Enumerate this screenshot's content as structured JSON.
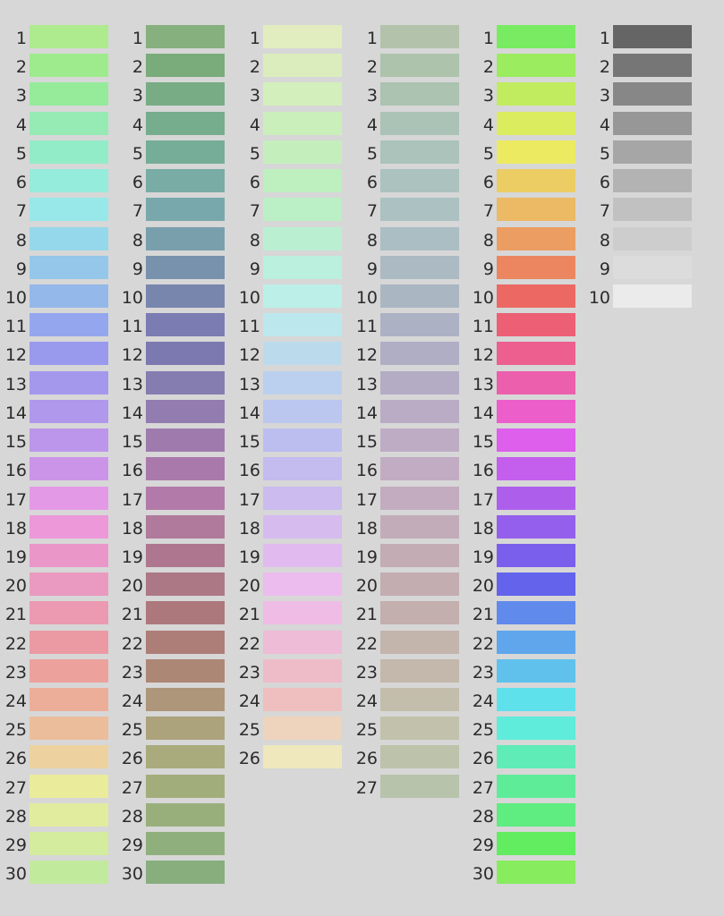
{
  "columns": [
    {
      "name": "column-1",
      "swatches": [
        {
          "num": "1",
          "color": "#aeea8e"
        },
        {
          "num": "2",
          "color": "#9eeb8e"
        },
        {
          "num": "3",
          "color": "#95eb9a"
        },
        {
          "num": "4",
          "color": "#96ebb4"
        },
        {
          "num": "5",
          "color": "#92ecc7"
        },
        {
          "num": "6",
          "color": "#95ebdc"
        },
        {
          "num": "7",
          "color": "#98e8ea"
        },
        {
          "num": "8",
          "color": "#95d8eb"
        },
        {
          "num": "9",
          "color": "#94c7ea"
        },
        {
          "num": "10",
          "color": "#95b8ea"
        },
        {
          "num": "11",
          "color": "#94a7ee"
        },
        {
          "num": "12",
          "color": "#9999ee"
        },
        {
          "num": "13",
          "color": "#a498ed"
        },
        {
          "num": "14",
          "color": "#b098ec"
        },
        {
          "num": "15",
          "color": "#bc96ea"
        },
        {
          "num": "16",
          "color": "#cc94e8"
        },
        {
          "num": "17",
          "color": "#e499e6"
        },
        {
          "num": "18",
          "color": "#ec98d9"
        },
        {
          "num": "19",
          "color": "#eb96c9"
        },
        {
          "num": "20",
          "color": "#ea9ac0"
        },
        {
          "num": "21",
          "color": "#eb9ab1"
        },
        {
          "num": "22",
          "color": "#eb9aa4"
        },
        {
          "num": "23",
          "color": "#eca19c"
        },
        {
          "num": "24",
          "color": "#ecae98"
        },
        {
          "num": "25",
          "color": "#ecbd9b"
        },
        {
          "num": "26",
          "color": "#edd29f"
        },
        {
          "num": "27",
          "color": "#ebeb9c"
        },
        {
          "num": "28",
          "color": "#e2ec9e"
        },
        {
          "num": "29",
          "color": "#d3ec9d"
        },
        {
          "num": "30",
          "color": "#c2ea9d"
        }
      ]
    },
    {
      "name": "column-2",
      "swatches": [
        {
          "num": "1",
          "color": "#86b07d"
        },
        {
          "num": "2",
          "color": "#7aab7b"
        },
        {
          "num": "3",
          "color": "#78ac84"
        },
        {
          "num": "4",
          "color": "#76ad8d"
        },
        {
          "num": "5",
          "color": "#76ad98"
        },
        {
          "num": "6",
          "color": "#78aca4"
        },
        {
          "num": "7",
          "color": "#78a8ac"
        },
        {
          "num": "8",
          "color": "#799fad"
        },
        {
          "num": "9",
          "color": "#7892ad"
        },
        {
          "num": "10",
          "color": "#7886ae"
        },
        {
          "num": "11",
          "color": "#7a7cb2"
        },
        {
          "num": "12",
          "color": "#7c78b0"
        },
        {
          "num": "13",
          "color": "#857cb0"
        },
        {
          "num": "14",
          "color": "#937caf"
        },
        {
          "num": "15",
          "color": "#9f7bad"
        },
        {
          "num": "16",
          "color": "#aa79ac"
        },
        {
          "num": "17",
          "color": "#b27aa9"
        },
        {
          "num": "18",
          "color": "#b07a9c"
        },
        {
          "num": "19",
          "color": "#ae778f"
        },
        {
          "num": "20",
          "color": "#ad7885"
        },
        {
          "num": "21",
          "color": "#ac787c"
        },
        {
          "num": "22",
          "color": "#ad7d77"
        },
        {
          "num": "23",
          "color": "#ad8776"
        },
        {
          "num": "24",
          "color": "#ad9679"
        },
        {
          "num": "25",
          "color": "#aca27b"
        },
        {
          "num": "26",
          "color": "#a9ab7c"
        },
        {
          "num": "27",
          "color": "#a2ad7c"
        },
        {
          "num": "28",
          "color": "#99af7b"
        },
        {
          "num": "29",
          "color": "#8fb07d"
        },
        {
          "num": "30",
          "color": "#88ae7e"
        }
      ]
    },
    {
      "name": "column-3",
      "swatches": [
        {
          "num": "1",
          "color": "#e1edbf"
        },
        {
          "num": "2",
          "color": "#dbedbc"
        },
        {
          "num": "3",
          "color": "#d3efbb"
        },
        {
          "num": "4",
          "color": "#caefbb"
        },
        {
          "num": "5",
          "color": "#c4efbd"
        },
        {
          "num": "6",
          "color": "#bdefbf"
        },
        {
          "num": "7",
          "color": "#bbefc6"
        },
        {
          "num": "8",
          "color": "#bbefd2"
        },
        {
          "num": "9",
          "color": "#bbefde"
        },
        {
          "num": "10",
          "color": "#bcefe8"
        },
        {
          "num": "11",
          "color": "#bce8ed"
        },
        {
          "num": "12",
          "color": "#bbdbed"
        },
        {
          "num": "13",
          "color": "#bbd0ee"
        },
        {
          "num": "14",
          "color": "#bbc7ef"
        },
        {
          "num": "15",
          "color": "#bbbeef"
        },
        {
          "num": "16",
          "color": "#c4bbef"
        },
        {
          "num": "17",
          "color": "#cbbbef"
        },
        {
          "num": "18",
          "color": "#d6bbef"
        },
        {
          "num": "19",
          "color": "#e1bbef"
        },
        {
          "num": "20",
          "color": "#ecbcee"
        },
        {
          "num": "21",
          "color": "#eebce4"
        },
        {
          "num": "22",
          "color": "#eebcd6"
        },
        {
          "num": "23",
          "color": "#eebcc8"
        },
        {
          "num": "24",
          "color": "#eebfbe"
        },
        {
          "num": "25",
          "color": "#eed4bc"
        },
        {
          "num": "26",
          "color": "#eee8bc"
        }
      ]
    },
    {
      "name": "column-4",
      "swatches": [
        {
          "num": "1",
          "color": "#b3c3ab"
        },
        {
          "num": "2",
          "color": "#adc3ac"
        },
        {
          "num": "3",
          "color": "#abc3b0"
        },
        {
          "num": "4",
          "color": "#abc3b6"
        },
        {
          "num": "5",
          "color": "#abc3ba"
        },
        {
          "num": "6",
          "color": "#abc2bf"
        },
        {
          "num": "7",
          "color": "#abc1c2"
        },
        {
          "num": "8",
          "color": "#abbec3"
        },
        {
          "num": "9",
          "color": "#abbac3"
        },
        {
          "num": "10",
          "color": "#abb6c3"
        },
        {
          "num": "11",
          "color": "#adb1c4"
        },
        {
          "num": "12",
          "color": "#afaec4"
        },
        {
          "num": "13",
          "color": "#b3acc4"
        },
        {
          "num": "14",
          "color": "#b9acc4"
        },
        {
          "num": "15",
          "color": "#beacc4"
        },
        {
          "num": "16",
          "color": "#c2acc3"
        },
        {
          "num": "17",
          "color": "#c3acbf"
        },
        {
          "num": "18",
          "color": "#c3acb9"
        },
        {
          "num": "19",
          "color": "#c3acb4"
        },
        {
          "num": "20",
          "color": "#c3adb0"
        },
        {
          "num": "21",
          "color": "#c3afad"
        },
        {
          "num": "22",
          "color": "#c3b4ac"
        },
        {
          "num": "23",
          "color": "#c3b8ab"
        },
        {
          "num": "24",
          "color": "#c3bdab"
        },
        {
          "num": "25",
          "color": "#c2c1ab"
        },
        {
          "num": "26",
          "color": "#bdc3ab"
        },
        {
          "num": "27",
          "color": "#b8c3ab"
        }
      ]
    },
    {
      "name": "column-5",
      "swatches": [
        {
          "num": "1",
          "color": "#79eb62"
        },
        {
          "num": "2",
          "color": "#9bec5e"
        },
        {
          "num": "3",
          "color": "#c1ec5f"
        },
        {
          "num": "4",
          "color": "#dcec5f"
        },
        {
          "num": "5",
          "color": "#ebea61"
        },
        {
          "num": "6",
          "color": "#eccd64"
        },
        {
          "num": "7",
          "color": "#ecb965"
        },
        {
          "num": "8",
          "color": "#ec9d62"
        },
        {
          "num": "9",
          "color": "#ec8660"
        },
        {
          "num": "10",
          "color": "#ec6963"
        },
        {
          "num": "11",
          "color": "#ec5f75"
        },
        {
          "num": "12",
          "color": "#ec5f8e"
        },
        {
          "num": "13",
          "color": "#ec5fac"
        },
        {
          "num": "14",
          "color": "#ec5fcb"
        },
        {
          "num": "15",
          "color": "#dd5fec"
        },
        {
          "num": "16",
          "color": "#c35fec"
        },
        {
          "num": "17",
          "color": "#ad5fec"
        },
        {
          "num": "18",
          "color": "#945fec"
        },
        {
          "num": "19",
          "color": "#7a5fec"
        },
        {
          "num": "20",
          "color": "#6363ec"
        },
        {
          "num": "21",
          "color": "#608aec"
        },
        {
          "num": "22",
          "color": "#5fa6ec"
        },
        {
          "num": "23",
          "color": "#5fc1ec"
        },
        {
          "num": "24",
          "color": "#5fe1ec"
        },
        {
          "num": "25",
          "color": "#5fecdb"
        },
        {
          "num": "26",
          "color": "#5fecb7"
        },
        {
          "num": "27",
          "color": "#5fec99"
        },
        {
          "num": "28",
          "color": "#5fec80"
        },
        {
          "num": "29",
          "color": "#62ec5f"
        },
        {
          "num": "30",
          "color": "#88ec5f"
        }
      ]
    },
    {
      "name": "column-6",
      "swatches": [
        {
          "num": "1",
          "color": "#656565"
        },
        {
          "num": "2",
          "color": "#767676"
        },
        {
          "num": "3",
          "color": "#878787"
        },
        {
          "num": "4",
          "color": "#979797"
        },
        {
          "num": "5",
          "color": "#a6a6a6"
        },
        {
          "num": "6",
          "color": "#b3b3b3"
        },
        {
          "num": "7",
          "color": "#c1c1c1"
        },
        {
          "num": "8",
          "color": "#cdcdcd"
        },
        {
          "num": "9",
          "color": "#dcdcdc"
        },
        {
          "num": "10",
          "color": "#ebebeb"
        }
      ]
    }
  ]
}
